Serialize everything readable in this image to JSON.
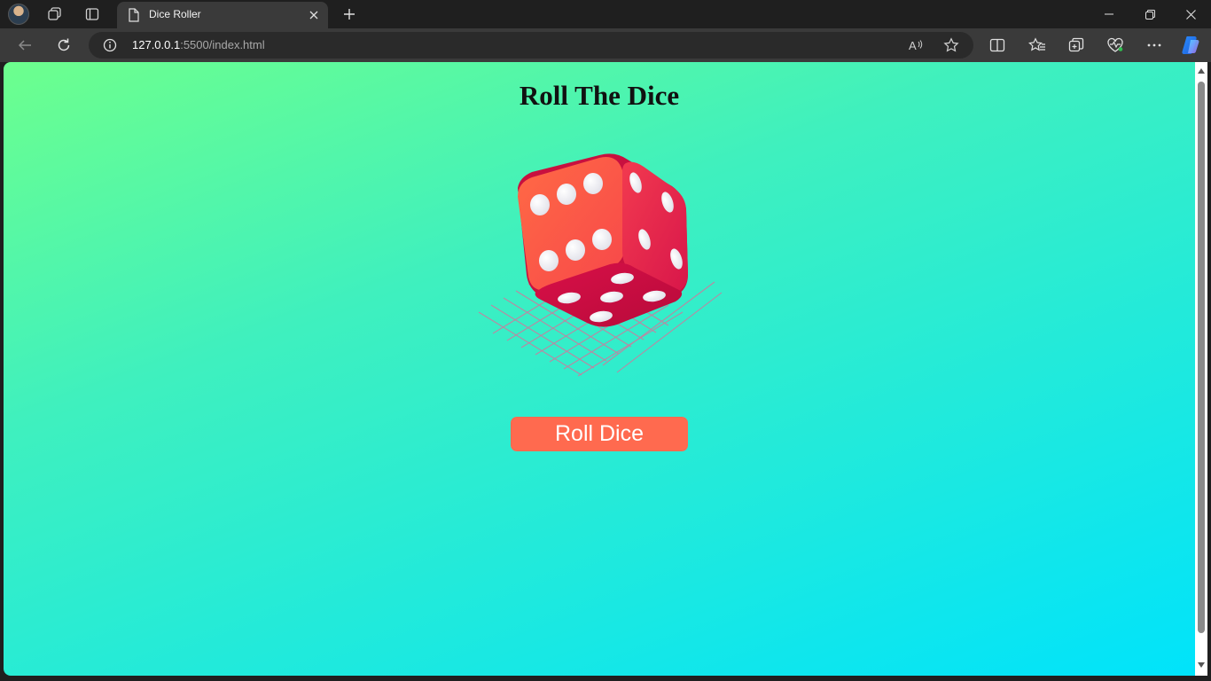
{
  "browser": {
    "tab": {
      "title": "Dice Roller"
    },
    "address": {
      "host": "127.0.0.1",
      "path": ":5500/index.html"
    }
  },
  "page": {
    "heading": "Roll The Dice",
    "button_label": "Roll Dice"
  },
  "colors": {
    "button": "#ff6a4f",
    "gradient_start": "#6dff8d",
    "gradient_end": "#00e3fb",
    "dice_face": "#ff5a4a",
    "dice_dark": "#c8103f"
  },
  "icons": [
    "profile-avatar",
    "workspaces-icon",
    "tab-actions-icon",
    "document-icon",
    "close-icon",
    "plus-icon",
    "minimize-icon",
    "restore-icon",
    "close-window-icon",
    "back-arrow-icon",
    "refresh-icon",
    "info-icon",
    "read-aloud-icon",
    "favorite-star-icon",
    "split-screen-icon",
    "favorites-icon",
    "collections-icon",
    "browser-essentials-icon",
    "more-icon",
    "copilot-icon",
    "dice-icon"
  ]
}
